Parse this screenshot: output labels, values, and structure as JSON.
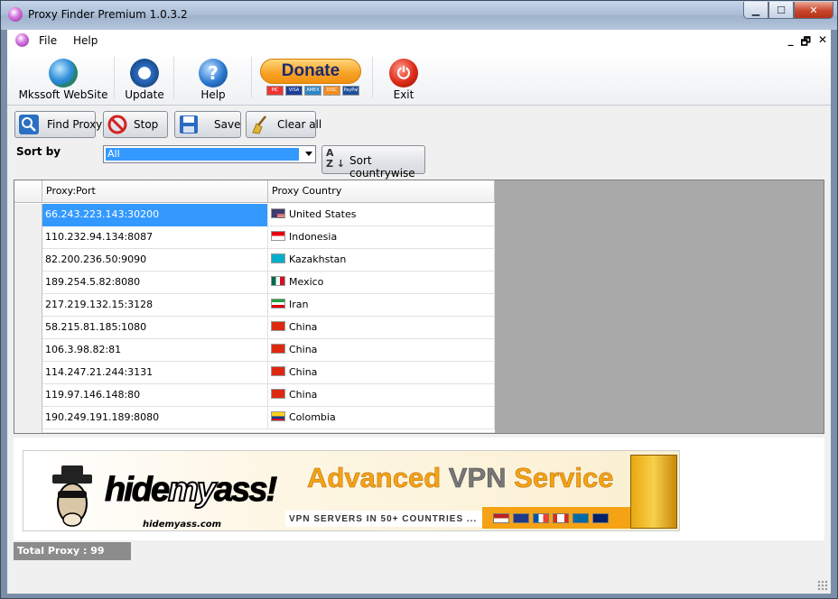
{
  "window": {
    "title": "Proxy Finder Premium 1.0.3.2",
    "minimize": "▁",
    "maximize": "☐",
    "close": "✕"
  },
  "menu": {
    "items": [
      "File",
      "Help"
    ],
    "mdi": {
      "minimize": "_",
      "restore": "🗗",
      "close": "✕"
    }
  },
  "toolbar": {
    "website": "Mkssoft WebSite",
    "update": "Update",
    "help": "Help",
    "donate": "Donate",
    "cards": [
      "MC",
      "VISA",
      "AMEX",
      "DISC",
      "PayPal"
    ],
    "exit": "Exit"
  },
  "controls": {
    "find": "Find Proxy",
    "stop": "Stop",
    "save": "Save",
    "clear": "Clear all",
    "sort_label": "Sort by",
    "sort_value": "All",
    "sort_countrywise": "Sort countrywise",
    "sort_icon": "A\nZ"
  },
  "grid": {
    "columns": [
      "Proxy:Port",
      "Proxy Country"
    ],
    "rows": [
      {
        "proxy": "66.243.223.143:30200",
        "country": "United States",
        "flag": "us"
      },
      {
        "proxy": "110.232.94.134:8087",
        "country": "Indonesia",
        "flag": "id"
      },
      {
        "proxy": "82.200.236.50:9090",
        "country": "Kazakhstan",
        "flag": "kz"
      },
      {
        "proxy": "189.254.5.82:8080",
        "country": "Mexico",
        "flag": "mx"
      },
      {
        "proxy": "217.219.132.15:3128",
        "country": "Iran",
        "flag": "ir"
      },
      {
        "proxy": "58.215.81.185:1080",
        "country": "China",
        "flag": "cn"
      },
      {
        "proxy": "106.3.98.82:81",
        "country": "China",
        "flag": "cn"
      },
      {
        "proxy": "114.247.21.244:3131",
        "country": "China",
        "flag": "cn"
      },
      {
        "proxy": "119.97.146.148:80",
        "country": "China",
        "flag": "cn"
      },
      {
        "proxy": "190.249.191.189:8080",
        "country": "Colombia",
        "flag": "co"
      }
    ]
  },
  "ad": {
    "brand_a": "hide",
    "brand_b": "my",
    "brand_c": "ass!",
    "url": "hidemyass.com",
    "title_a": "Advanced ",
    "title_b": "VPN",
    "title_c": " Service",
    "subtitle": "VPN SERVERS IN 50+ COUNTRIES ..."
  },
  "status": {
    "total": "Total Proxy : 99"
  },
  "colors": {
    "selection": "#3399ff",
    "ad_orange": "#f5a214"
  }
}
